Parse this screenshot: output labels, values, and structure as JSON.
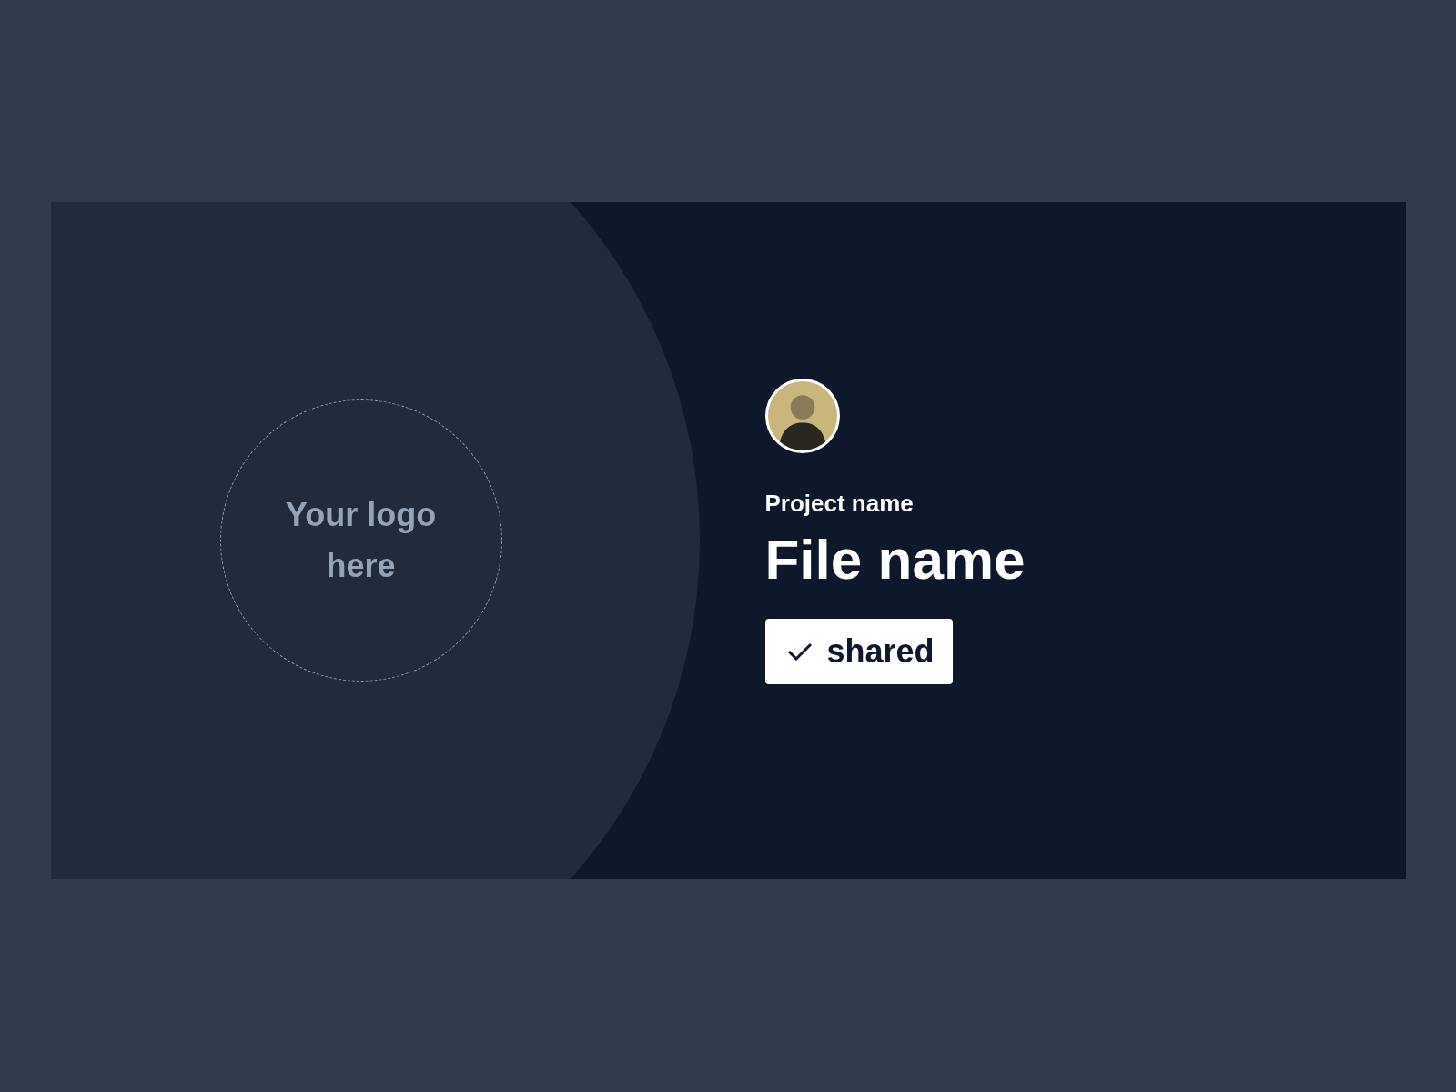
{
  "logo_placeholder": {
    "text": "Your logo here"
  },
  "project_name": "Project name",
  "file_name": "File name",
  "status_badge": {
    "label": "shared",
    "checked": true
  }
}
